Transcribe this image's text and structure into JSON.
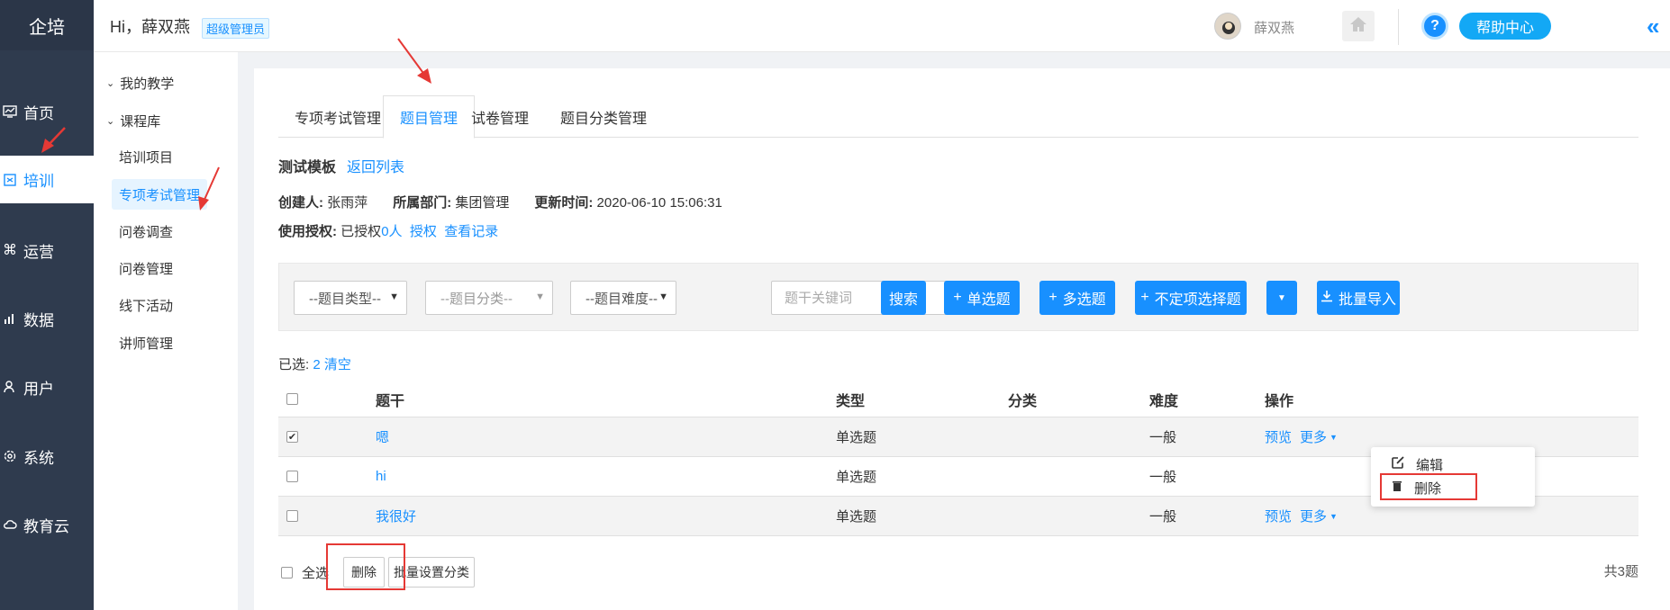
{
  "brand": "企培",
  "leftnav": [
    {
      "label": "首页",
      "icon": "dashboard-icon"
    },
    {
      "label": "培训",
      "icon": "book-icon",
      "active": true
    },
    {
      "label": "运营",
      "icon": "command-icon"
    },
    {
      "label": "数据",
      "icon": "bar-chart-icon"
    },
    {
      "label": "用户",
      "icon": "user-icon"
    },
    {
      "label": "系统",
      "icon": "gear-icon"
    },
    {
      "label": "教育云",
      "icon": "cloud-icon"
    }
  ],
  "header": {
    "greeting": "Hi，薛双燕",
    "role": "超级管理员",
    "user_name": "薛双燕",
    "help": "帮助中心",
    "help_q": "?"
  },
  "subnav": {
    "groups": [
      "我的教学",
      "课程库"
    ],
    "items": [
      "培训项目",
      "专项考试管理",
      "问卷调查",
      "问卷管理",
      "线下活动",
      "讲师管理"
    ],
    "active_item": "专项考试管理"
  },
  "tabs": [
    "专项考试管理",
    "题目管理",
    "试卷管理",
    "题目分类管理"
  ],
  "active_tab": "题目管理",
  "template": {
    "title": "测试模板",
    "back": "返回列表",
    "creator_label": "创建人:",
    "creator": "张雨萍",
    "dept_label": "所属部门:",
    "dept": "集团管理",
    "updated_label": "更新时间:",
    "updated": "2020-06-10 15:06:31",
    "auth_label": "使用授权:",
    "auth_status": "已授权",
    "auth_count": "0人",
    "auth_link": "授权",
    "records_link": "查看记录"
  },
  "filters": {
    "type": "--题目类型--",
    "category": "--题目分类--",
    "difficulty": "--题目难度--",
    "keyword_placeholder": "题干关键词",
    "search": "搜索",
    "single": "单选题",
    "multi": "多选题",
    "indef": "不定项选择题",
    "import": "批量导入"
  },
  "selection": {
    "label": "已选:",
    "count": "2",
    "clear": "清空"
  },
  "table": {
    "headers": [
      "题干",
      "类型",
      "分类",
      "难度",
      "操作"
    ],
    "rows": [
      {
        "stem": "嗯",
        "type": "单选题",
        "category": "",
        "difficulty": "一般",
        "checked": true
      },
      {
        "stem": "hi",
        "type": "单选题",
        "category": "",
        "difficulty": "一般",
        "checked": false
      },
      {
        "stem": "我很好",
        "type": "单选题",
        "category": "",
        "difficulty": "一般",
        "checked": false
      }
    ],
    "preview": "预览",
    "more": "更多"
  },
  "dropdown": {
    "edit": "编辑",
    "delete": "删除"
  },
  "footer": {
    "select_all": "全选",
    "delete": "删除",
    "batch_category": "批量设置分类",
    "total": "共3题"
  },
  "colors": {
    "primary": "#1890ff",
    "nav_bg": "#2f3b4e",
    "annotation": "#e53935"
  }
}
